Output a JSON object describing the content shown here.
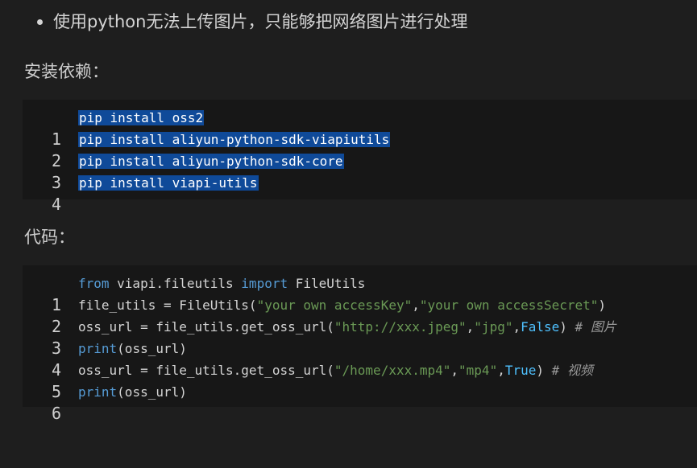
{
  "bullet": {
    "text": "使用python无法上传图片，只能够把网络图片进行处理"
  },
  "headings": {
    "install": "安装依赖：",
    "code": "代码："
  },
  "install_block": {
    "lines": [
      {
        "num": "1",
        "text": "pip install oss2"
      },
      {
        "num": "2",
        "text": "pip install aliyun-python-sdk-viapiutils"
      },
      {
        "num": "3",
        "text": "pip install aliyun-python-sdk-core"
      },
      {
        "num": "4",
        "text": "pip install viapi-utils"
      }
    ]
  },
  "code_block": {
    "line_numbers": [
      "1",
      "2",
      "3",
      "4",
      "5",
      "6"
    ],
    "l1": {
      "kw1": "from",
      "mod": " viapi.fileutils ",
      "kw2": "import",
      "name": " FileUtils"
    },
    "l2": {
      "a": "file_utils = FileUtils(",
      "s1": "\"your own accessKey\"",
      "comma": ",",
      "s2": "\"your own accessSecret\"",
      "end": ")"
    },
    "l3": {
      "a": "oss_url = file_utils.get_oss_url(",
      "s1": "\"http://xxx.jpeg\"",
      "c1": ",",
      "s2": "\"jpg\"",
      "c2": ",",
      "b": "False",
      "end": ") ",
      "cmt": "# 图片"
    },
    "l4": {
      "fn": "print",
      "rest": "(oss_url)"
    },
    "l5": {
      "a": "oss_url = file_utils.get_oss_url(",
      "s1": "\"/home/xxx.mp4\"",
      "c1": ",",
      "s2": "\"mp4\"",
      "c2": ",",
      "b": "True",
      "end": ") ",
      "cmt": "# 视频"
    },
    "l6": {
      "fn": "print",
      "rest": "(oss_url)"
    }
  },
  "colors": {
    "background": "#1e1e1e",
    "code_background": "#171717",
    "selection": "#0f4a99",
    "keyword": "#569cd6",
    "string": "#ce9178",
    "boolean": "#4fc1ff",
    "comment": "#9a9a9a"
  }
}
